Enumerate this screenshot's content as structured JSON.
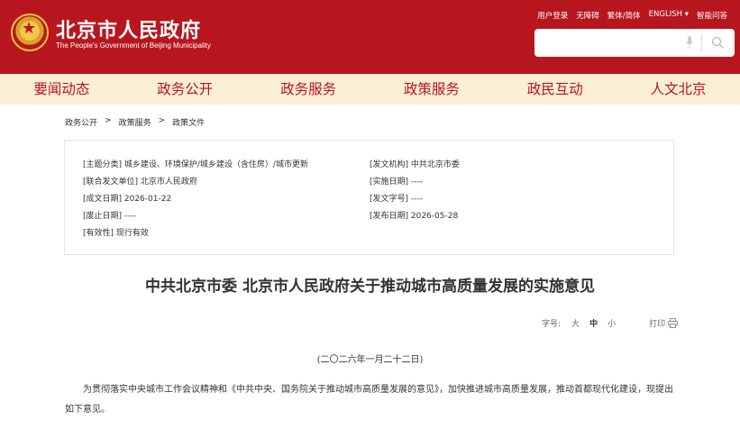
{
  "header": {
    "title": "北京市人民政府",
    "subtitle": "The People's Government of Beijing Municipality",
    "top_links": [
      "用户登录",
      "无障碍",
      "繁体/简体",
      "ENGLISH ▾",
      "智能问答"
    ],
    "search": {
      "placeholder": ""
    }
  },
  "nav": {
    "items": [
      "要闻动态",
      "政务公开",
      "政务服务",
      "政策服务",
      "政民互动",
      "人文北京"
    ]
  },
  "breadcrumb": {
    "items": [
      "政务公开",
      ">",
      "政策服务",
      ">",
      "政策文件"
    ]
  },
  "info": {
    "left": [
      "[主题分类] 城乡建设、环境保护/城乡建设（含住房）/城市更新",
      "[联合发文单位] 北京市人民政府",
      "[成文日期] 2026-01-22",
      "[废止日期] ----",
      "[有效性] 现行有效"
    ],
    "right": [
      "[发文机构] 中共北京市委",
      "[实施日期] ----",
      "[发文字号] ----",
      "[发布日期] 2026-05-28"
    ]
  },
  "document": {
    "title": "中共北京市委 北京市人民政府关于推动城市高质量发展的实施意见",
    "date": "(二〇二六年一月二十二日)",
    "paragraph": "为贯彻落实中央城市工作会议精神和《中共中央、国务院关于推动城市高质量发展的意见》，加快推进城市高质量发展，推动首都现代化建设，现提出如下意见。"
  },
  "tools": {
    "font_size_label": "字号:",
    "sizes": [
      "大",
      "中",
      "小"
    ],
    "print_label": "打印"
  },
  "colors": {
    "brand_red": "#b8161e",
    "nav_bg": "#fbeed6"
  },
  "icons": [
    "national-emblem-icon",
    "microphone-icon",
    "search-icon",
    "printer-icon"
  ]
}
